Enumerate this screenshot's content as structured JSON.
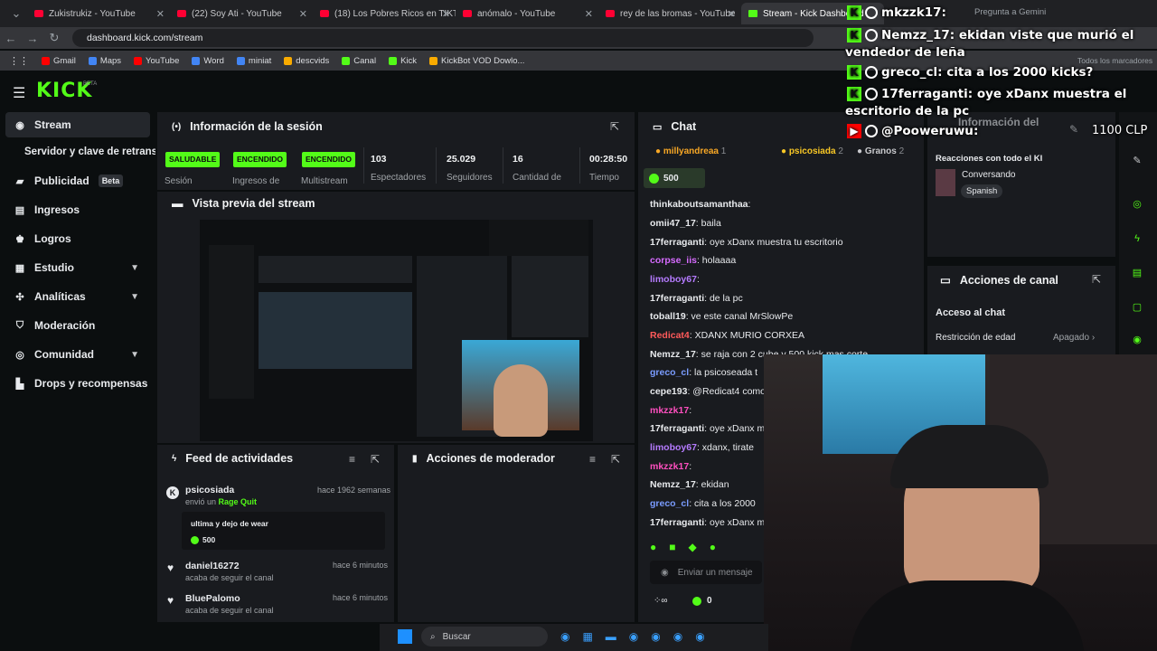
{
  "browser": {
    "tabs": [
      {
        "title": "Zukistrukiz - YouTube",
        "active": false
      },
      {
        "title": "(22) Soy Ati - YouTube",
        "active": false
      },
      {
        "title": "(18) Los Pobres Ricos en TIKTOK",
        "active": false
      },
      {
        "title": "anómalo - YouTube",
        "active": false
      },
      {
        "title": "rey de las bromas - YouTube",
        "active": false
      },
      {
        "title": "Stream - Kick Dashboard",
        "active": true
      }
    ],
    "gemini": "Pregunta a Gemini",
    "url": "dashboard.kick.com/stream",
    "bookmarks": [
      "Gmail",
      "Maps",
      "YouTube",
      "Word",
      "miniat",
      "descvids",
      "Canal",
      "Kick",
      "KickBot VOD Dowlo..."
    ],
    "all_bookmarks": "Todos los marcadores"
  },
  "kick": {
    "logo": "KICK",
    "beta": "BETA",
    "sidebar": [
      {
        "label": "Stream",
        "icon": "broadcast-icon",
        "active": true
      },
      {
        "label": "Servidor y clave de retransm",
        "icon": "",
        "active": false
      },
      {
        "label": "Publicidad",
        "icon": "megaphone-icon",
        "badge": "Beta"
      },
      {
        "label": "Ingresos",
        "icon": "coin-icon"
      },
      {
        "label": "Logros",
        "icon": "trophy-icon"
      },
      {
        "label": "Estudio",
        "icon": "studio-icon",
        "chevron": true
      },
      {
        "label": "Analíticas",
        "icon": "analytics-icon",
        "chevron": true
      },
      {
        "label": "Moderación",
        "icon": "shield-icon"
      },
      {
        "label": "Comunidad",
        "icon": "community-icon",
        "chevron": true
      },
      {
        "label": "Drops y recompensas",
        "icon": "drops-icon"
      }
    ],
    "session": {
      "title": "Información de la sesión",
      "stats": [
        {
          "value": "SALUDABLE",
          "label": "Sesión",
          "pill": true
        },
        {
          "value": "ENCENDIDO",
          "label": "Ingresos de",
          "pill": true
        },
        {
          "value": "ENCENDIDO",
          "label": "Multistream",
          "pill": true
        },
        {
          "value": "103",
          "label": "Espectadores"
        },
        {
          "value": "25.029",
          "label": "Seguidores"
        },
        {
          "value": "16",
          "label": "Cantidad de"
        },
        {
          "value": "00:28:50",
          "label": "Tiempo"
        }
      ]
    },
    "preview": {
      "title": "Vista previa del stream"
    },
    "feed": {
      "title": "Feed de actividades",
      "items": [
        {
          "user": "psicosiada",
          "action": "envió un",
          "highlight": "Rage Quit",
          "time": "hace 1962 semanas",
          "message": "ultima y dejo de wear",
          "amount": "500"
        },
        {
          "user": "daniel16272",
          "action": "acaba de seguir el canal",
          "time": "hace 6 minutos"
        },
        {
          "user": "BluePalomo",
          "action": "acaba de seguir el canal",
          "time": "hace 6 minutos"
        }
      ]
    },
    "mod_actions": {
      "title": "Acciones de moderador"
    },
    "chat": {
      "title": "Chat",
      "top_gifters": [
        {
          "name": "millyandreaa",
          "count": "1"
        },
        {
          "name": "psicosiada",
          "count": "2"
        },
        {
          "name": "Granos",
          "count": "2"
        }
      ],
      "pinned_amount": "500",
      "messages": [
        {
          "user": "thinkaboutsamanthaa",
          "text": "",
          "color": "#e8eaed"
        },
        {
          "user": "omii47_17",
          "text": "baila",
          "color": "#e8eaed"
        },
        {
          "user": "17ferraganti",
          "text": "oye xDanx muestra tu escritorio",
          "color": "#e8eaed"
        },
        {
          "user": "corpse_iis",
          "text": "holaaaa",
          "color": "#d66bff"
        },
        {
          "user": "limoboy67",
          "text": "",
          "color": "#b57bff"
        },
        {
          "user": "17ferraganti",
          "text": "de la pc",
          "color": "#e8eaed"
        },
        {
          "user": "toball19",
          "text": "ve este canal MrSlowPe",
          "color": "#e8eaed"
        },
        {
          "user": "Redicat4",
          "text": "XDANX MURIO CORXEA",
          "color": "#ff5a5a"
        },
        {
          "user": "Nemzz_17",
          "text": "se raja con 2 cube y 500 kick mas corte",
          "color": "#e8eaed"
        },
        {
          "user": "greco_cl",
          "text": "la psicoseada t",
          "color": "#7a9cff"
        },
        {
          "user": "cepe193",
          "text": "@Redicat4 como c",
          "color": "#e8eaed"
        },
        {
          "user": "mkzzk17",
          "text": "",
          "color": "#ff4fbf"
        },
        {
          "user": "17ferraganti",
          "text": "oye xDanx mue",
          "color": "#e8eaed"
        },
        {
          "user": "limoboy67",
          "text": "xdanx, tirate",
          "color": "#b57bff"
        },
        {
          "user": "mkzzk17",
          "text": "",
          "color": "#ff4fbf"
        },
        {
          "user": "Nemzz_17",
          "text": "ekidan",
          "color": "#e8eaed"
        },
        {
          "user": "greco_cl",
          "text": "cita a los 2000",
          "color": "#7a9cff"
        },
        {
          "user": "17ferraganti",
          "text": "oye xDanx mue",
          "color": "#e8eaed"
        }
      ],
      "placeholder": "Enviar un mensaje",
      "kicks": "0"
    },
    "side_panel": {
      "title": "Información del",
      "reactions": "Reacciones con todo el KI",
      "activity": "Conversando",
      "language": "Spanish"
    },
    "channel_actions": {
      "title": "Acciones de canal",
      "section": "Acceso al chat",
      "age_label": "Restricción de edad",
      "age_value": "Apagado"
    }
  },
  "overlay": {
    "lines": [
      {
        "user": "mkzzk17",
        "text": ""
      },
      {
        "user": "Nemzz_17",
        "text": "ekidan viste que murió el"
      },
      {
        "user": "",
        "text": "vendedor de leña"
      },
      {
        "user": "greco_cl",
        "text": "cita a los 2000 kicks?"
      },
      {
        "user": "17ferraganti",
        "text": "oye xDanx muestra el"
      },
      {
        "user": "",
        "text": "escritorio de la pc"
      },
      {
        "user": "@Pooweruwu",
        "text": ""
      }
    ],
    "clp": "1100 CLP"
  },
  "taskbar": {
    "search": "Buscar"
  },
  "colors": {
    "kick_green": "#53fc18",
    "panel": "#191b1f",
    "background": "#0b0e0f"
  }
}
